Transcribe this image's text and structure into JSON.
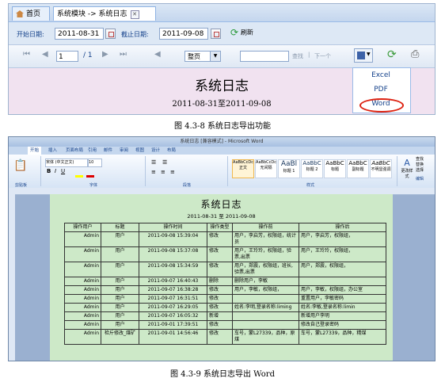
{
  "screenshot1": {
    "tabs": [
      {
        "label": "首页"
      },
      {
        "label": "系统模块 -> 系统日志"
      }
    ],
    "date_filter": {
      "start_label": "开始日期:",
      "start_value": "2011-08-31",
      "end_label": "截止日期:",
      "end_value": "2011-09-08",
      "refresh_label": "刷新"
    },
    "pager": {
      "page_value": "1",
      "page_total": "/ 1",
      "zoom_value": "整页",
      "find_label": "查找",
      "next_label": "下一个"
    },
    "report": {
      "title": "系统日志",
      "range": "2011-08-31至2011-09-08"
    },
    "export_menu": [
      "Excel",
      "PDF",
      "Word"
    ],
    "caption": "图 4.3-8  系统日志导出功能"
  },
  "screenshot2": {
    "window_title": "系统日志 [兼容模式] - Microsoft Word",
    "ribbon_tabs": [
      "开始",
      "插入",
      "页面布局",
      "引用",
      "邮件",
      "审阅",
      "视图",
      "设计",
      "布局"
    ],
    "ribbon_groups": [
      "剪贴板",
      "字体",
      "段落",
      "样式",
      "编辑"
    ],
    "font_name": "宋体 (中文正文)",
    "font_size": "10",
    "styles": [
      {
        "preview": "AaBbCcDc",
        "name": "正文"
      },
      {
        "preview": "AaBbCcDc",
        "name": "无间隔"
      },
      {
        "preview": "AaBl",
        "name": "标题 1"
      },
      {
        "preview": "AaBbC",
        "name": "标题 2"
      },
      {
        "preview": "AaBbC",
        "name": "标题"
      },
      {
        "preview": "AaBbC",
        "name": "副标题"
      },
      {
        "preview": "AaBbC",
        "name": "不明显强调"
      }
    ],
    "change_styles_label": "更改样式",
    "edit_actions": [
      "查找",
      "替换",
      "选择"
    ],
    "doc_title": "系统日志",
    "doc_range": "2011-08-31 至 2011-09-08",
    "table": {
      "headers": [
        "操作用户",
        "标题",
        "操作时间",
        "操作类型",
        "操作前",
        "操作后"
      ],
      "rows": [
        [
          "Admin",
          "用户",
          "2011-09-08 15:39:04",
          "修改",
          "用户，李启芳，权限组，统计员",
          "用户，李启芳，权限组，"
        ],
        [
          "Admin",
          "用户",
          "2011-09-08 15:37:08",
          "修改",
          "用户，王玲玲，权限组，验票,出票",
          "用户，王玲玲，权限组，"
        ],
        [
          "Admin",
          "用户",
          "2011-09-08 15:34:59",
          "修改",
          "用户，郑震，权限组，班长,验票,出票",
          "用户，郑震，权限组，"
        ],
        [
          "Admin",
          "用户",
          "2011-09-07 16:40:43",
          "删除",
          "删除用户，李敏",
          ""
        ],
        [
          "Admin",
          "用户",
          "2011-09-07 16:38:28",
          "修改",
          "用户，李敏，权限组，",
          "用户，李敏，权限组，办公室"
        ],
        [
          "Admin",
          "用户",
          "2011-09-07 16:31:51",
          "修改",
          "",
          "重置用户，李敏密码"
        ],
        [
          "Admin",
          "用户",
          "2011-09-07 16:29:05",
          "修改",
          "姓名:李明,登录名称:liming",
          "姓名:李敏,登录名称:limin"
        ],
        [
          "Admin",
          "用户",
          "2011-09-07 16:05:32",
          "新增",
          "",
          "新增用户李明"
        ],
        [
          "Admin",
          "用户",
          "2011-09-01 17:39:51",
          "修改",
          "",
          "修改自己登录密码"
        ],
        [
          "Admin",
          "检斤修改_煤矿",
          "2011-09-01 14:56:46",
          "修改",
          "车号，蒙L27339，品种，原煤",
          "车号，蒙L27339，品种，精煤"
        ]
      ]
    },
    "caption": "图 4.3-9  系统日志导出 Word"
  },
  "colors": {
    "report_bg": "#f1e2f0",
    "doc_page_bg": "#cde9c8",
    "highlight_oval": "#dd1111",
    "toolbar_blue": "#dde8f5"
  }
}
